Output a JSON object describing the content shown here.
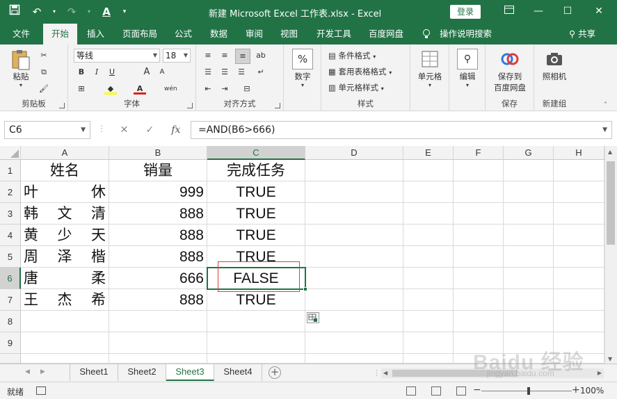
{
  "window": {
    "title": "新建 Microsoft Excel 工作表.xlsx  -  Excel",
    "login_label": "登录",
    "brand_color": "#217346"
  },
  "menu": {
    "tabs": [
      "文件",
      "开始",
      "插入",
      "页面布局",
      "公式",
      "数据",
      "审阅",
      "视图",
      "开发工具",
      "百度网盘"
    ],
    "active_tab": "开始",
    "tell_me": "操作说明搜索",
    "share": "共享"
  },
  "ribbon": {
    "clipboard": {
      "paste": "粘贴",
      "label": "剪贴板"
    },
    "font": {
      "name": "等线",
      "size": "18",
      "label": "字体",
      "bold": "B",
      "italic": "I",
      "underline": "U",
      "grow": "A",
      "shrink": "A",
      "phonetic": "wén"
    },
    "alignment": {
      "label": "对齐方式"
    },
    "number": {
      "button": "数字",
      "symbol": "%"
    },
    "styles": {
      "conditional": "条件格式",
      "table": "套用表格格式",
      "cell": "单元格样式",
      "label": "样式"
    },
    "cells": {
      "button": "单元格"
    },
    "editing": {
      "button": "编辑"
    },
    "save": {
      "button": "保存到\n百度网盘",
      "line1": "保存到",
      "line2": "百度网盘",
      "label": "保存"
    },
    "camera": {
      "button": "照相机",
      "label": "新建组"
    }
  },
  "formula_bar": {
    "name_box": "C6",
    "formula": "=AND(B6>666)",
    "fx": "fx"
  },
  "columns": [
    "A",
    "B",
    "C",
    "D",
    "E",
    "F",
    "G",
    "H"
  ],
  "selected_column": "C",
  "rows": [
    "1",
    "2",
    "3",
    "4",
    "5",
    "6",
    "7",
    "8",
    "9"
  ],
  "selected_row": "6",
  "sheet": {
    "headers": [
      "姓名",
      "销量",
      "完成任务"
    ],
    "data": [
      {
        "name": [
          "叶",
          "",
          "休"
        ],
        "sales": "999",
        "done": "TRUE"
      },
      {
        "name": [
          "韩",
          "文",
          "清"
        ],
        "sales": "888",
        "done": "TRUE"
      },
      {
        "name": [
          "黄",
          "少",
          "天"
        ],
        "sales": "888",
        "done": "TRUE"
      },
      {
        "name": [
          "周",
          "泽",
          "楷"
        ],
        "sales": "888",
        "done": "TRUE"
      },
      {
        "name": [
          "唐",
          "",
          "柔"
        ],
        "sales": "666",
        "done": "FALSE"
      },
      {
        "name": [
          "王",
          "杰",
          "希"
        ],
        "sales": "888",
        "done": "TRUE"
      }
    ]
  },
  "sheet_tabs": [
    "Sheet1",
    "Sheet2",
    "Sheet3",
    "Sheet4"
  ],
  "active_sheet": "Sheet3",
  "status": {
    "ready": "就绪",
    "zoom": "100%"
  },
  "watermark": {
    "main": "Baidu 经验",
    "sub": "jingyan.baidu.com"
  }
}
